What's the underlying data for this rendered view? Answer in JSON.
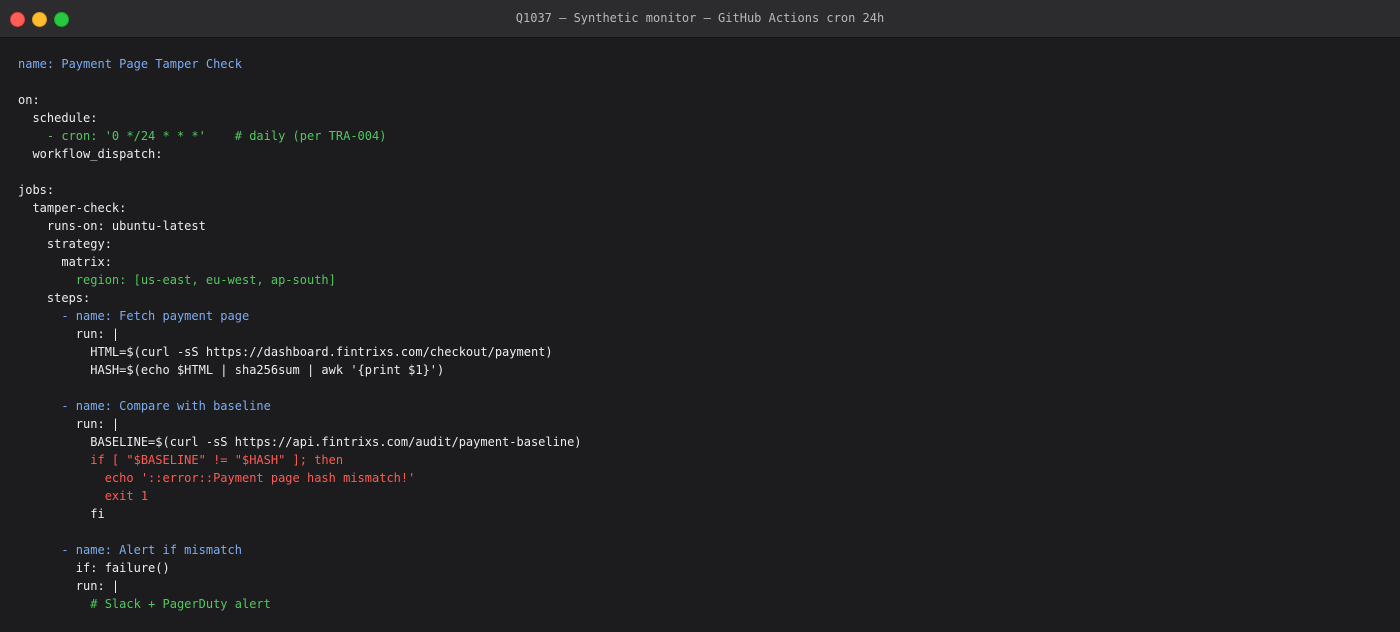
{
  "window": {
    "title": "Q1037 — Synthetic monitor — GitHub Actions cron 24h"
  },
  "colors": {
    "default": "#ececec",
    "key_blue": "#7aacf2",
    "comment_green": "#50c85e",
    "error_red": "#ff5a52"
  },
  "code": {
    "lines": [
      {
        "text": "name: Payment Page Tamper Check",
        "color": "blue"
      },
      {
        "text": "",
        "color": "white"
      },
      {
        "text": "on:",
        "color": "white"
      },
      {
        "text": "  schedule:",
        "color": "white"
      },
      {
        "text": "    - cron: '0 */24 * * *'    # daily (per TRA-004)",
        "color": "green"
      },
      {
        "text": "  workflow_dispatch:",
        "color": "white"
      },
      {
        "text": "",
        "color": "white"
      },
      {
        "text": "jobs:",
        "color": "white"
      },
      {
        "text": "  tamper-check:",
        "color": "white"
      },
      {
        "text": "    runs-on: ubuntu-latest",
        "color": "white"
      },
      {
        "text": "    strategy:",
        "color": "white"
      },
      {
        "text": "      matrix:",
        "color": "white"
      },
      {
        "text": "        region: [us-east, eu-west, ap-south]",
        "color": "green"
      },
      {
        "text": "    steps:",
        "color": "white"
      },
      {
        "text": "      - name: Fetch payment page",
        "color": "blue"
      },
      {
        "text": "        run: |",
        "color": "white"
      },
      {
        "text": "          HTML=$(curl -sS https://dashboard.fintrixs.com/checkout/payment)",
        "color": "white"
      },
      {
        "text": "          HASH=$(echo $HTML | sha256sum | awk '{print $1}')",
        "color": "white"
      },
      {
        "text": "",
        "color": "white"
      },
      {
        "text": "      - name: Compare with baseline",
        "color": "blue"
      },
      {
        "text": "        run: |",
        "color": "white"
      },
      {
        "text": "          BASELINE=$(curl -sS https://api.fintrixs.com/audit/payment-baseline)",
        "color": "white"
      },
      {
        "text": "          if [ \"$BASELINE\" != \"$HASH\" ]; then",
        "color": "red"
      },
      {
        "text": "            echo '::error::Payment page hash mismatch!'",
        "color": "red"
      },
      {
        "text": "            exit 1",
        "color": "red"
      },
      {
        "text": "          fi",
        "color": "white"
      },
      {
        "text": "",
        "color": "white"
      },
      {
        "text": "      - name: Alert if mismatch",
        "color": "blue"
      },
      {
        "text": "        if: failure()",
        "color": "white"
      },
      {
        "text": "        run: |",
        "color": "white"
      },
      {
        "text": "          # Slack + PagerDuty alert",
        "color": "green"
      }
    ]
  }
}
